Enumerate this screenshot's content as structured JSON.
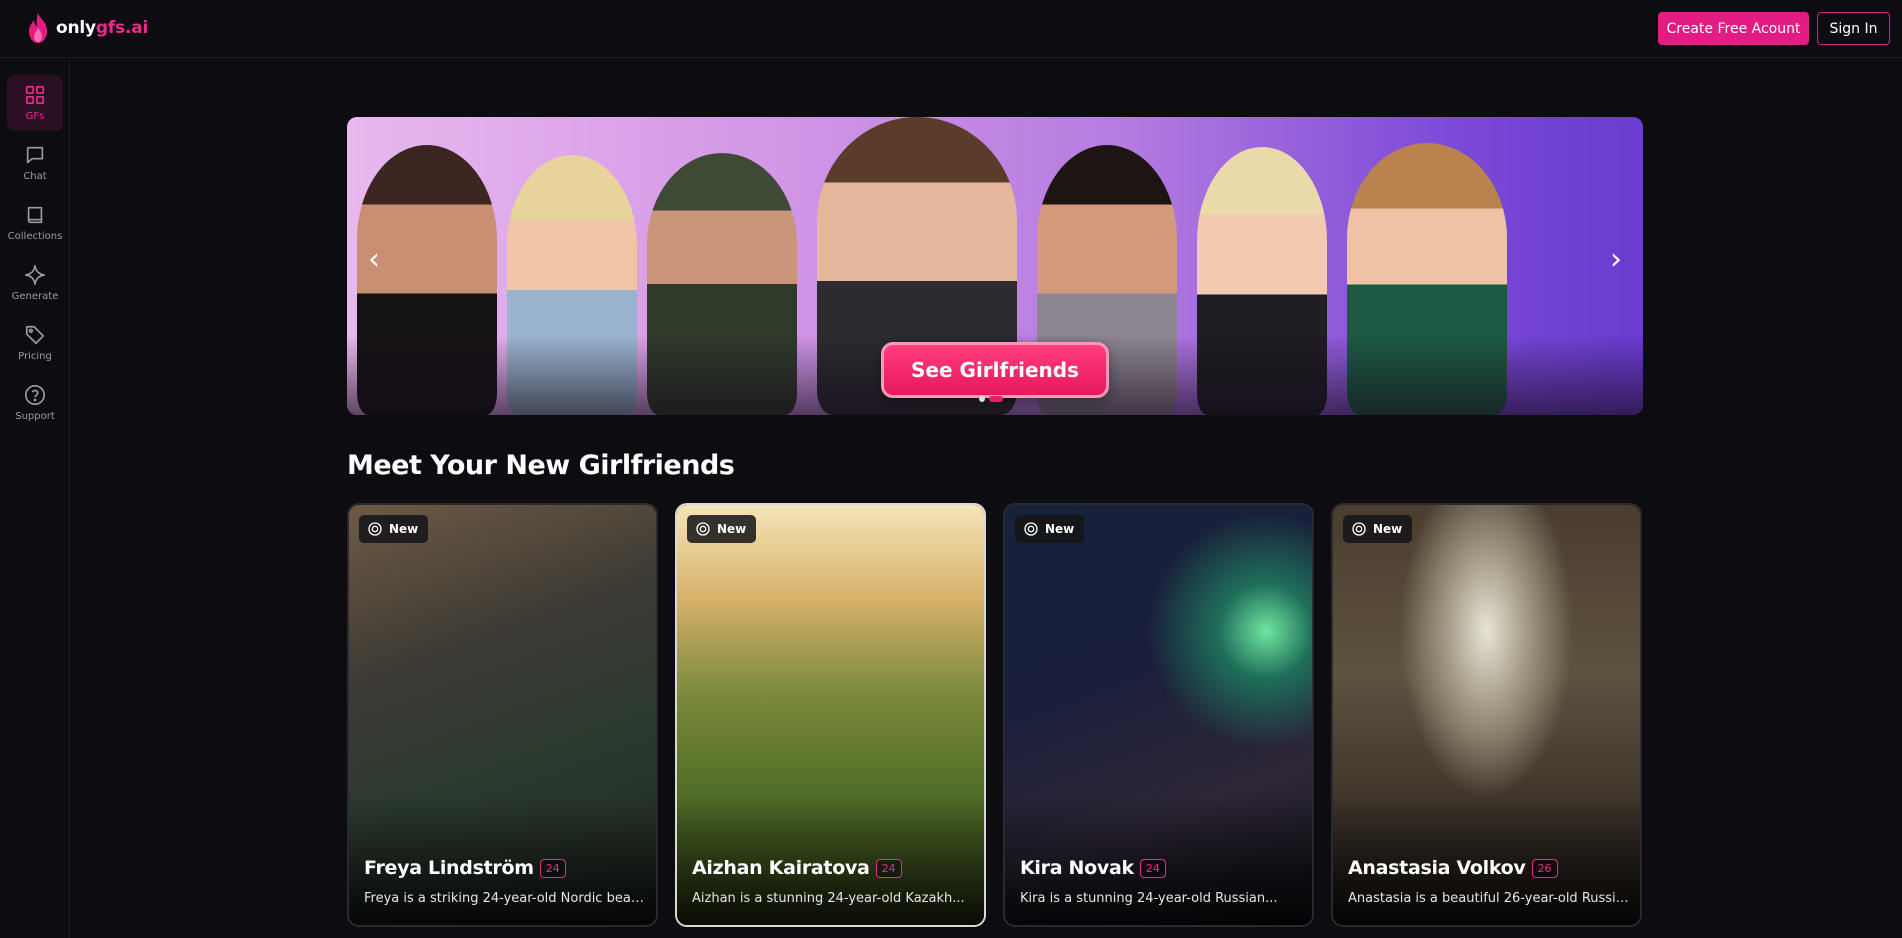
{
  "header": {
    "logo_prefix": "only",
    "logo_suffix": "gfs.ai",
    "create_account_label": "Create Free Acount",
    "sign_in_label": "Sign In",
    "brand_color": "#e31c83"
  },
  "sidebar": {
    "items": [
      {
        "label": "GFs",
        "icon": "grid-icon",
        "active": true
      },
      {
        "label": "Chat",
        "icon": "chat-icon"
      },
      {
        "label": "Collections",
        "icon": "book-icon"
      },
      {
        "label": "Generate",
        "icon": "sparkle-icon"
      },
      {
        "label": "Pricing",
        "icon": "tag-icon"
      },
      {
        "label": "Support",
        "icon": "help-circle-icon"
      }
    ]
  },
  "hero": {
    "cta_label": "See Girlfriends",
    "prev_icon": "chevron-left-icon",
    "next_icon": "chevron-right-icon",
    "slide_count": 2,
    "active_slide": 2
  },
  "main": {
    "section_title": "Meet Your New Girlfriends",
    "cards": [
      {
        "badge": "New",
        "name": "Freya Lindström",
        "age": "24",
        "description": "Freya is a striking 24-year-old Nordic beau..."
      },
      {
        "badge": "New",
        "name": "Aizhan Kairatova",
        "age": "24",
        "description": "Aizhan is a stunning 24-year-old Kazakh..."
      },
      {
        "badge": "New",
        "name": "Kira Novak",
        "age": "24",
        "description": "Kira is a stunning 24-year-old Russian..."
      },
      {
        "badge": "New",
        "name": "Anastasia Volkov",
        "age": "26",
        "description": "Anastasia is a beautiful 26-year-old Russia..."
      }
    ]
  }
}
